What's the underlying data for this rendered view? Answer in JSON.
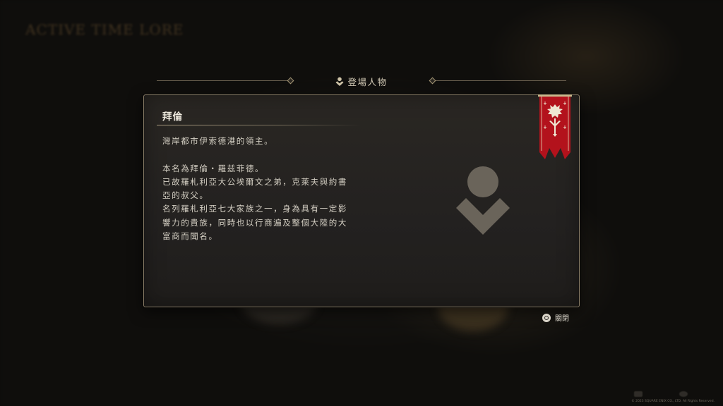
{
  "background": {
    "title": "ACTIVE TIME LORE",
    "subtitle": "",
    "captions": [
      "",
      ""
    ],
    "copyright": "© 2023 SQUARE ENIX CO., LTD. All Rights Reserved."
  },
  "header": {
    "icon": "character-icon",
    "title": "登場人物"
  },
  "entry": {
    "name": "拜倫",
    "paragraphs": [
      [
        "灣岸都市伊索德港的領主。"
      ],
      [
        "本名為拜倫・羅兹菲德。",
        "已故羅札利亞大公埃爾文之弟，克萊夫與約書",
        "亞的叔父。",
        "名列羅札利亞七大家族之一，身為具有一定影",
        "響力的貴族，同時也以行商遍及整個大陸的大",
        "富商而聞名。"
      ]
    ],
    "portrait_icon": "person-silhouette-icon",
    "banner_icon": "rosaria-crest-banner-icon"
  },
  "prompt": {
    "button_icon": "circle-button-icon",
    "label": "關閉"
  },
  "colors": {
    "accent_gold": "#a39574",
    "banner_red": "#b3121c",
    "panel_bg": "#262320",
    "text": "#d4cfc3"
  }
}
